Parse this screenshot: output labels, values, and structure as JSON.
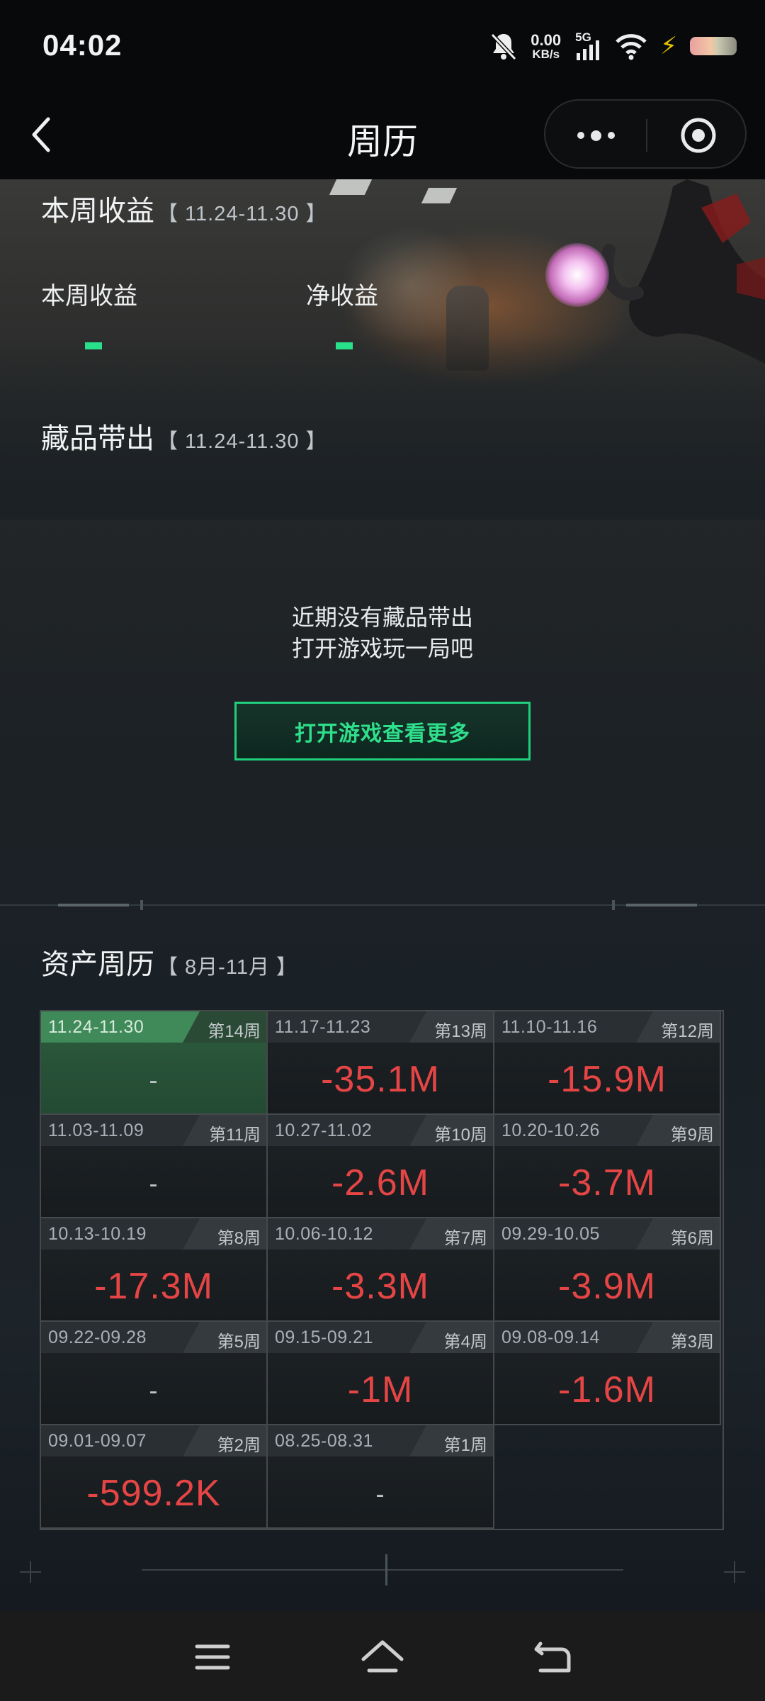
{
  "status_bar": {
    "time": "04:02",
    "net_speed_value": "0.00",
    "net_speed_unit": "KB/s",
    "network": "5G"
  },
  "header": {
    "title": "周历"
  },
  "weekly_income": {
    "title": "本周收益",
    "range": "【 11.24-11.30 】",
    "income_label": "本周收益",
    "net_label": "净收益"
  },
  "collectibles": {
    "title": "藏品带出",
    "range": "【 11.24-11.30 】",
    "empty_line1": "近期没有藏品带出",
    "empty_line2": "打开游戏玩一局吧",
    "button_label": "打开游戏查看更多"
  },
  "asset_calendar": {
    "title": "资产周历",
    "range": "【 8月-11月 】",
    "weeks": [
      {
        "date": "11.24-11.30",
        "week": "第14周",
        "value": "-",
        "active": true
      },
      {
        "date": "11.17-11.23",
        "week": "第13周",
        "value": "-35.1M"
      },
      {
        "date": "11.10-11.16",
        "week": "第12周",
        "value": "-15.9M"
      },
      {
        "date": "11.03-11.09",
        "week": "第11周",
        "value": "-"
      },
      {
        "date": "10.27-11.02",
        "week": "第10周",
        "value": "-2.6M"
      },
      {
        "date": "10.20-10.26",
        "week": "第9周",
        "value": "-3.7M"
      },
      {
        "date": "10.13-10.19",
        "week": "第8周",
        "value": "-17.3M"
      },
      {
        "date": "10.06-10.12",
        "week": "第7周",
        "value": "-3.3M"
      },
      {
        "date": "09.29-10.05",
        "week": "第6周",
        "value": "-3.9M"
      },
      {
        "date": "09.22-09.28",
        "week": "第5周",
        "value": "-"
      },
      {
        "date": "09.15-09.21",
        "week": "第4周",
        "value": "-1M"
      },
      {
        "date": "09.08-09.14",
        "week": "第3周",
        "value": "-1.6M"
      },
      {
        "date": "09.01-09.07",
        "week": "第2周",
        "value": "-599.2K"
      },
      {
        "date": "08.25-08.31",
        "week": "第1周",
        "value": "-"
      }
    ]
  },
  "colors": {
    "accent_green": "#28e089",
    "loss_red": "#e64545"
  }
}
